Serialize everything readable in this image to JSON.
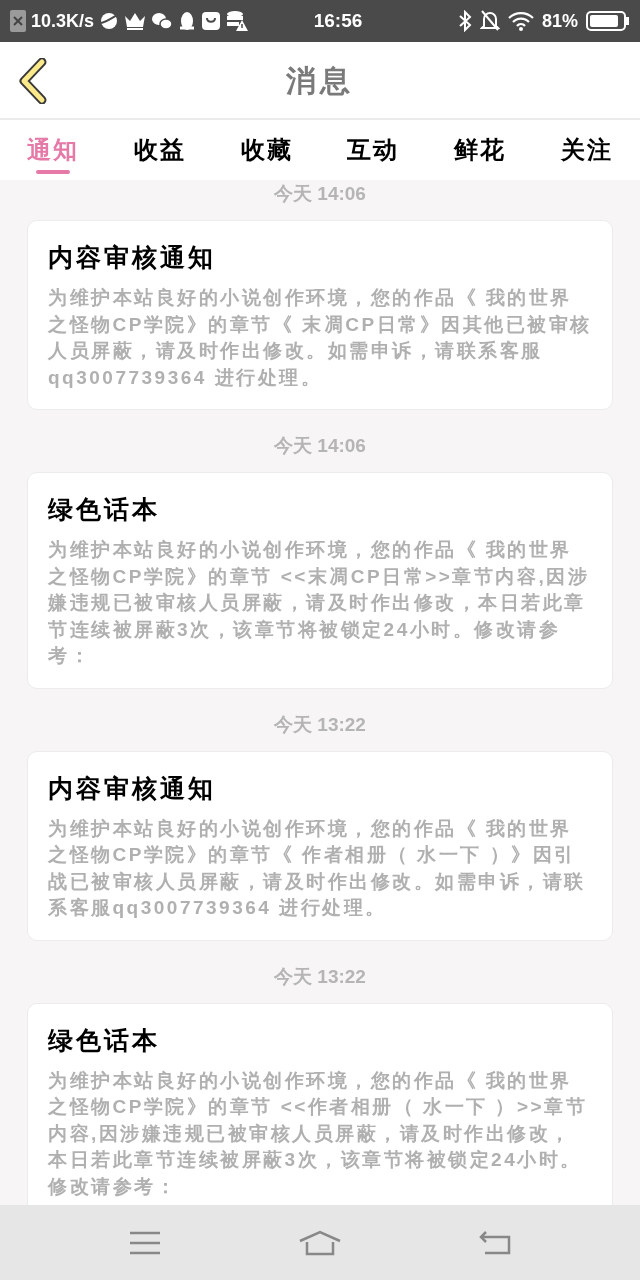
{
  "status_bar": {
    "net_speed": "10.3K/s",
    "time": "16:56",
    "battery": "81%"
  },
  "header": {
    "title": "消息"
  },
  "tabs": [
    {
      "label": "通知",
      "selected": true
    },
    {
      "label": "收益",
      "selected": false
    },
    {
      "label": "收藏",
      "selected": false
    },
    {
      "label": "互动",
      "selected": false
    },
    {
      "label": "鲜花",
      "selected": false
    },
    {
      "label": "关注",
      "selected": false
    }
  ],
  "messages": [
    {
      "timestamp": "今天 14:06",
      "title": "内容审核通知",
      "body": "为维护本站良好的小说创作环境，您的作品《 我的世界之怪物CP学院》的章节《 末凋CP日常》因其他已被审核人员屏蔽，请及时作出修改。如需申诉，请联系客服qq3007739364 进行处理。"
    },
    {
      "timestamp": "今天 14:06",
      "title": "绿色话本",
      "body": "为维护本站良好的小说创作环境，您的作品《 我的世界之怪物CP学院》的章节 <<末凋CP日常>>章节内容,因涉嫌违规已被审核人员屏蔽，请及时作出修改，本日若此章节连续被屏蔽3次，该章节将被锁定24小时。修改请参考："
    },
    {
      "timestamp": "今天 13:22",
      "title": "内容审核通知",
      "body": "为维护本站良好的小说创作环境，您的作品《 我的世界之怪物CP学院》的章节《 作者相册（ 水一下 ）》因引战已被审核人员屏蔽，请及时作出修改。如需申诉，请联系客服qq3007739364 进行处理。"
    },
    {
      "timestamp": "今天 13:22",
      "title": "绿色话本",
      "body": "为维护本站良好的小说创作环境，您的作品《 我的世界之怪物CP学院》的章节 <<作者相册（ 水一下 ）>>章节内容,因涉嫌违规已被审核人员屏蔽，请及时作出修改，本日若此章节连续被屏蔽3次，该章节将被锁定24小时。修改请参考："
    }
  ]
}
